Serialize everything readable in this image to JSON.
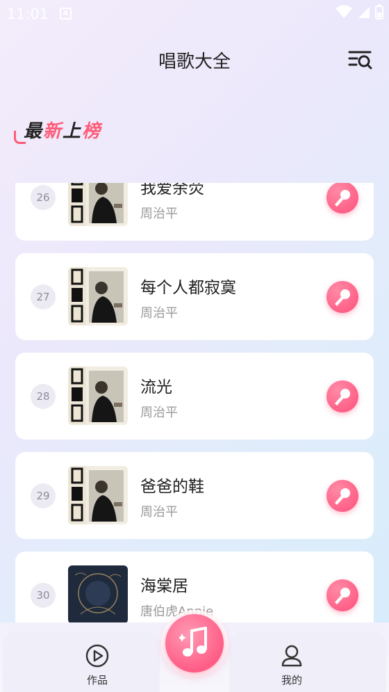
{
  "status": {
    "time": "11:01",
    "notif_glyph": "A"
  },
  "header": {
    "title": "唱歌大全",
    "search_icon": "search-list-icon"
  },
  "section": {
    "chars": [
      "最",
      "新",
      "上",
      "榜"
    ]
  },
  "songs": [
    {
      "rank": "26",
      "title": "我爱余荧",
      "artist": "周治平",
      "cover": "zhou"
    },
    {
      "rank": "27",
      "title": "每个人都寂寞",
      "artist": "周治平",
      "cover": "zhou"
    },
    {
      "rank": "28",
      "title": "流光",
      "artist": "周治平",
      "cover": "zhou"
    },
    {
      "rank": "29",
      "title": "爸爸的鞋",
      "artist": "周治平",
      "cover": "zhou"
    },
    {
      "rank": "30",
      "title": "海棠居",
      "artist": "唐伯虎Annie",
      "cover": "night"
    }
  ],
  "nav": {
    "works": "作品",
    "mine": "我的"
  },
  "colors": {
    "accent": "#ff5c7a"
  }
}
